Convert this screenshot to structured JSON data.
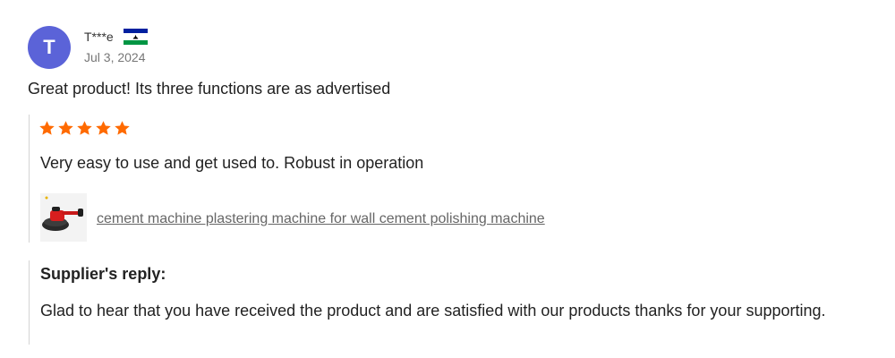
{
  "review": {
    "avatar_initial": "T",
    "avatar_color": "#5b63d8",
    "reviewer_name": "T***e",
    "country_flag_icon": "lesotho-flag-icon",
    "date": "Jul 3, 2024",
    "title": "Great product! Its three functions are as advertised",
    "rating": 5,
    "rating_max": 5,
    "star_color": "#ff6a00",
    "body": "Very easy to use and get used to. Robust in operation",
    "product": {
      "thumbnail_icon": "cement-polishing-machine-thumbnail",
      "link_text": "cement machine plastering machine for wall cement polishing machine"
    }
  },
  "supplier_reply": {
    "heading": "Supplier's reply:",
    "body": "Glad to hear that you have received the product and are satisfied with our products thanks for your supporting."
  }
}
